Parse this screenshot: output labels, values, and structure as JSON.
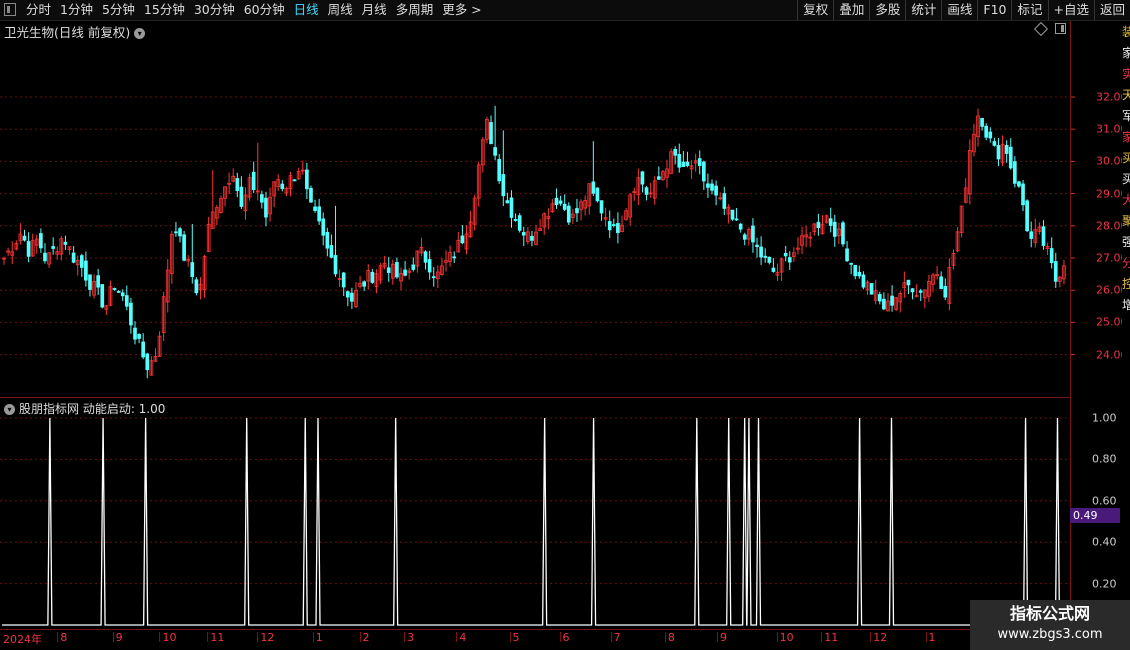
{
  "menu_icon": "menu-icon",
  "periods": [
    "分时",
    "1分钟",
    "5分钟",
    "15分钟",
    "30分钟",
    "60分钟",
    "日线",
    "周线",
    "月线",
    "多周期",
    "更多 >"
  ],
  "active_period_index": 6,
  "toolbar": [
    "复权",
    "叠加",
    "多股",
    "统计",
    "画线",
    "F10",
    "标记",
    "+自选",
    "返回"
  ],
  "stock_title": "卫光生物(日线 前复权)",
  "price_axis_labels": [
    "32.00",
    "31.00",
    "30.00",
    "29.00",
    "28.00",
    "27.00",
    "26.00",
    "25.00",
    "24.00"
  ],
  "indicator_title": "股朋指标网  动能启动: 1.00",
  "indicator_axis_labels": [
    "1.00",
    "0.80",
    "0.60",
    "0.40",
    "0.20"
  ],
  "indicator_current_value": "0.49",
  "time_axis": {
    "year_label": "2024年",
    "months": [
      "8",
      "9",
      "10",
      "11",
      "12",
      "1",
      "2",
      "3",
      "4",
      "5",
      "6",
      "7",
      "8",
      "9",
      "10",
      "11",
      "12",
      "1"
    ]
  },
  "right_strip_glyphs": [
    "装",
    "家",
    "实",
    "天",
    "军",
    "家",
    "买",
    "买",
    "大",
    "聚",
    "强",
    "分",
    "控",
    "增"
  ],
  "watermark": {
    "title": "指标公式网",
    "url": "www.zbgs3.com"
  },
  "colors": {
    "up": "#ff3434",
    "down": "#54ffff",
    "signal": "#ffffff",
    "grid": "#6a1010",
    "accent": "#3fdcff",
    "badge": "#4a1a7a"
  },
  "chart_data": [
    {
      "type": "candlestick",
      "title": "卫光生物(日线 前复权)",
      "y_ticks": [
        32,
        31,
        30,
        29,
        28,
        27,
        26,
        25,
        24
      ],
      "x_ticks": [
        "2024年",
        "8",
        "9",
        "10",
        "11",
        "12",
        "1",
        "2",
        "3",
        "4",
        "5",
        "6",
        "7",
        "8",
        "9",
        "10",
        "11",
        "12",
        "1"
      ],
      "close_path": [
        27.0,
        27.4,
        27.8,
        27.2,
        27.6,
        26.9,
        27.3,
        27.7,
        27.1,
        26.8,
        26.3,
        25.9,
        25.5,
        26.2,
        25.8,
        25.0,
        24.2,
        23.6,
        24.1,
        26.0,
        28.3,
        27.2,
        26.6,
        25.8,
        27.8,
        28.7,
        29.2,
        29.8,
        28.5,
        29.3,
        29.1,
        28.2,
        29.6,
        29.2,
        29.5,
        29.9,
        28.6,
        28.1,
        27.3,
        26.8,
        26.2,
        25.7,
        26.1,
        26.4,
        26.6,
        26.9,
        26.5,
        26.3,
        26.7,
        27.2,
        26.9,
        26.4,
        26.8,
        27.1,
        27.6,
        28.3,
        29.9,
        31.2,
        30.1,
        28.9,
        28.4,
        27.9,
        27.6,
        28.1,
        28.4,
        28.9,
        28.6,
        28.2,
        28.6,
        29.1,
        28.7,
        28.3,
        27.8,
        28.3,
        29.2,
        29.5,
        28.9,
        29.3,
        29.9,
        30.2,
        29.6,
        29.9,
        29.7,
        29.2,
        28.8,
        28.5,
        28.1,
        27.9,
        27.6,
        27.2,
        26.8,
        26.5,
        26.9,
        27.2,
        27.4,
        27.8,
        28.1,
        28.3,
        27.9,
        27.4,
        26.8,
        26.3,
        26.1,
        25.7,
        25.4,
        25.8,
        26.0,
        26.2,
        25.9,
        26.3,
        26.6,
        26.0,
        27.2,
        28.5,
        30.6,
        31.6,
        30.8,
        30.2,
        30.6,
        29.6,
        28.9,
        27.5,
        27.8,
        27.2,
        26.3,
        26.9
      ]
    },
    {
      "type": "line",
      "title": "股朋指标网  动能启动: 1.00",
      "y_ticks": [
        1.0,
        0.8,
        0.6,
        0.4,
        0.2
      ],
      "signal_positions": [
        0.045,
        0.095,
        0.135,
        0.23,
        0.285,
        0.297,
        0.37,
        0.51,
        0.556,
        0.653,
        0.683,
        0.698,
        0.702,
        0.711,
        0.806,
        0.836,
        0.962,
        0.992
      ],
      "current_value": 0.49
    }
  ]
}
